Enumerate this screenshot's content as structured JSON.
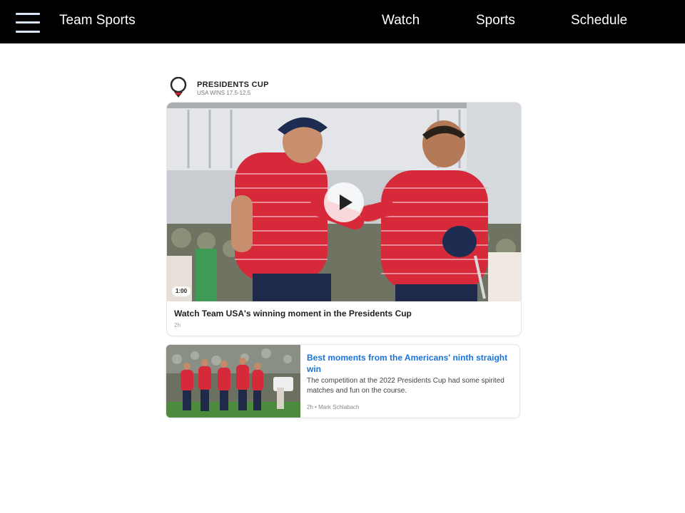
{
  "nav": {
    "brand": "Team Sports",
    "links": [
      "Watch",
      "Sports",
      "Schedule"
    ]
  },
  "event": {
    "title": "PRESIDENTS CUP",
    "subtitle": "USA WINS 17.5-12.5"
  },
  "video": {
    "duration": "1:00",
    "title": "Watch Team USA's winning moment in the Presidents Cup",
    "time": "2h"
  },
  "article": {
    "headline": "Best moments from the Americans' ninth straight win",
    "summary": "The competition at the 2022 Presidents Cup had some spirited matches and fun on the course.",
    "meta": "2h • Mark Schlabach"
  },
  "icons": {
    "menu": "hamburger-icon",
    "event_logo": "presidents-cup-logo-icon",
    "play": "play-icon"
  },
  "colors": {
    "topbar": "#000000",
    "headline_link": "#1a73d9",
    "team_shirt": "#d62a3a"
  }
}
